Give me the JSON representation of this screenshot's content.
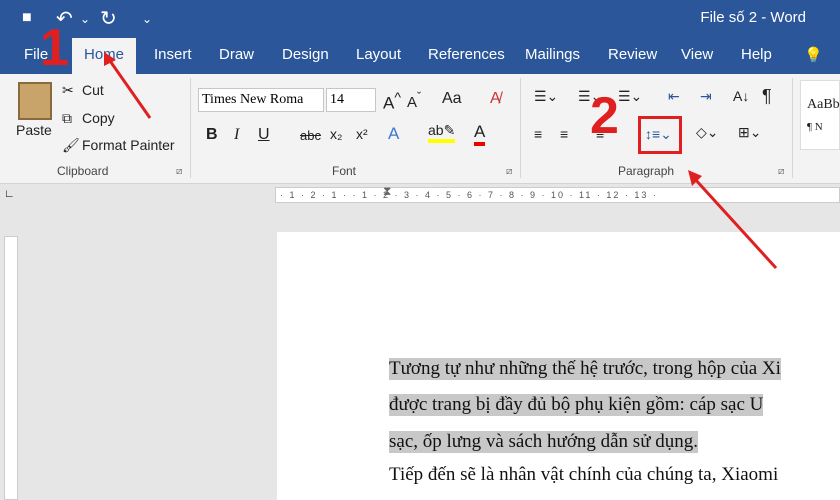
{
  "window": {
    "title": "File số 2  -  Word"
  },
  "qat": {
    "save": "💾",
    "undo": "↶",
    "undo_dd": "⌄",
    "redo": "↻",
    "customize": "⌄"
  },
  "tabs": [
    "File",
    "Home",
    "Insert",
    "Draw",
    "Design",
    "Layout",
    "References",
    "Mailings",
    "Review",
    "View",
    "Help"
  ],
  "tell_icon": "💡",
  "clipboard": {
    "paste": "Paste",
    "cut": "Cut",
    "copy": "Copy",
    "format_painter": "Format Painter",
    "label": "Clipboard"
  },
  "font": {
    "name": "Times New Roma",
    "size": "14",
    "label": "Font",
    "bold": "B",
    "italic": "I",
    "underline": "U",
    "strike": "abc",
    "sub": "x₂",
    "sup": "x²",
    "grow": "A^",
    "shrink": "Aˇ",
    "case": "Aa"
  },
  "paragraph": {
    "label": "Paragraph"
  },
  "styles": {
    "preview": "AaBb",
    "name": "¶ N"
  },
  "callouts": {
    "one": "1",
    "two": "2"
  },
  "ruler": {
    "marks": "· 1 · 2 · 1 ·   · 1 · 2 · 3 · 4 · 5 · 6 · 7 · 8 · 9 · 10 · 11 · 12 · 13 ·"
  },
  "document": {
    "lines": [
      "Tương tự như những thế hệ trước, trong hộp của Xi",
      "được trang bị đầy đủ bộ phụ kiện gồm: cáp sạc U",
      "sạc, ốp lưng và sách hướng dẫn sử dụng.",
      "Tiếp đến sẽ là nhân vật chính của chúng ta, Xiaomi"
    ]
  },
  "colors": {
    "accent": "#2b579a",
    "callout": "#e02020"
  }
}
